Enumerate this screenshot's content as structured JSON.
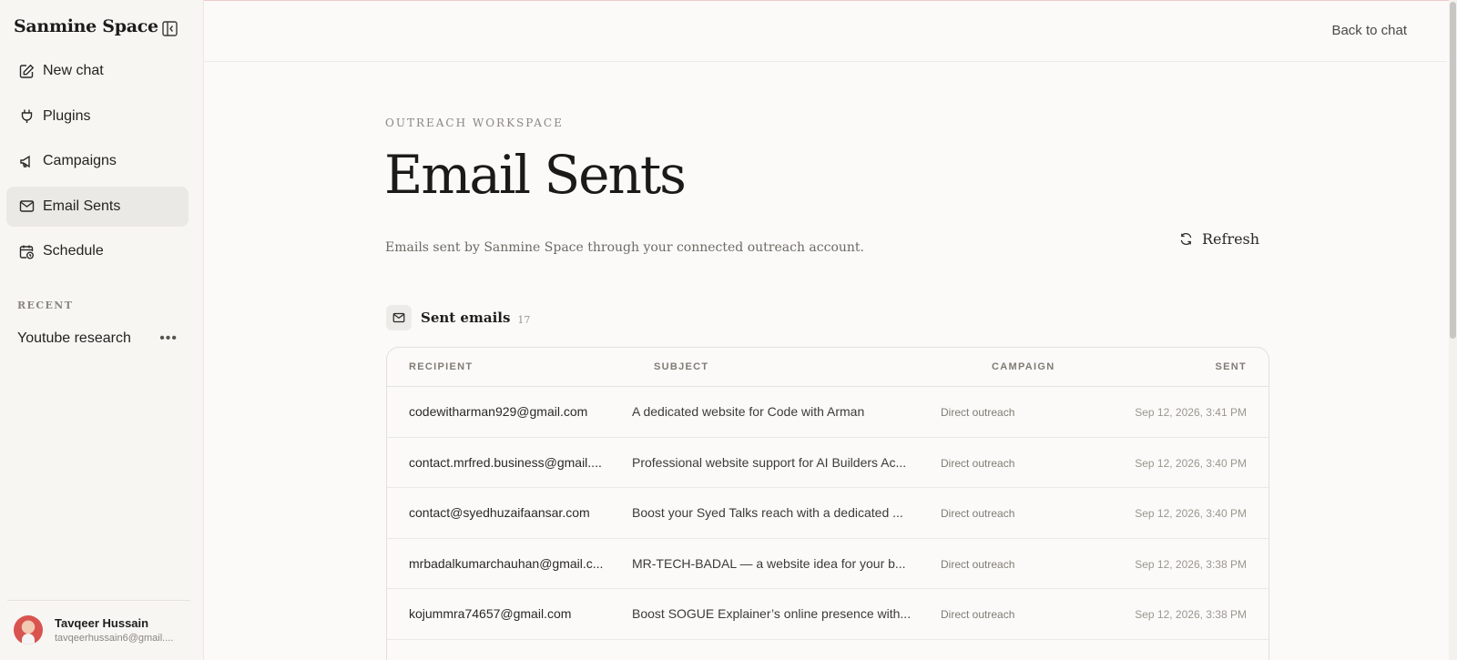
{
  "app": {
    "brand": "Sanmine Space"
  },
  "sidebar": {
    "items": [
      {
        "label": "New chat",
        "icon": "edit-icon"
      },
      {
        "label": "Plugins",
        "icon": "plug-icon"
      },
      {
        "label": "Campaigns",
        "icon": "megaphone-icon"
      },
      {
        "label": "Email Sents",
        "icon": "mail-icon",
        "active": true
      },
      {
        "label": "Schedule",
        "icon": "calendar-clock-icon"
      }
    ],
    "recent_heading": "RECENT",
    "recent": [
      {
        "label": "Youtube research"
      }
    ],
    "user": {
      "name": "Tavqeer Hussain",
      "email": "tavqeerhussain6@gmail...."
    }
  },
  "header": {
    "back_label": "Back to chat"
  },
  "page": {
    "eyebrow": "OUTREACH WORKSPACE",
    "title": "Email Sents",
    "subtitle": "Emails sent by Sanmine Space through your connected outreach account.",
    "refresh_label": "Refresh",
    "section_label": "Sent emails",
    "section_count": "17"
  },
  "table": {
    "headers": {
      "recipient": "RECIPIENT",
      "subject": "SUBJECT",
      "campaign": "CAMPAIGN",
      "sent": "SENT"
    },
    "rows": [
      {
        "recipient": "codewitharman929@gmail.com",
        "subject": "A dedicated website for Code with Arman",
        "campaign": "Direct outreach",
        "sent": "Sep 12, 2026, 3:41 PM"
      },
      {
        "recipient": "contact.mrfred.business@gmail....",
        "subject": "Professional website support for AI Builders Ac...",
        "campaign": "Direct outreach",
        "sent": "Sep 12, 2026, 3:40 PM"
      },
      {
        "recipient": "contact@syedhuzaifaansar.com",
        "subject": "Boost your Syed Talks reach with a dedicated ...",
        "campaign": "Direct outreach",
        "sent": "Sep 12, 2026, 3:40 PM"
      },
      {
        "recipient": "mrbadalkumarchauhan@gmail.c...",
        "subject": "MR-TECH-BADAL — a website idea for your b...",
        "campaign": "Direct outreach",
        "sent": "Sep 12, 2026, 3:38 PM"
      },
      {
        "recipient": "kojummra74657@gmail.com",
        "subject": "Boost SOGUE Explainer’s online presence with...",
        "campaign": "Direct outreach",
        "sent": "Sep 12, 2026, 3:38 PM"
      },
      {
        "recipient": "",
        "subject": "",
        "campaign": "",
        "sent": ""
      }
    ]
  },
  "colors": {
    "background": "#fbfaf8",
    "sidebar": "#f7f6f3",
    "active_nav": "#ebe9e5",
    "text": "#1f1e1c",
    "muted": "#8a8780"
  }
}
